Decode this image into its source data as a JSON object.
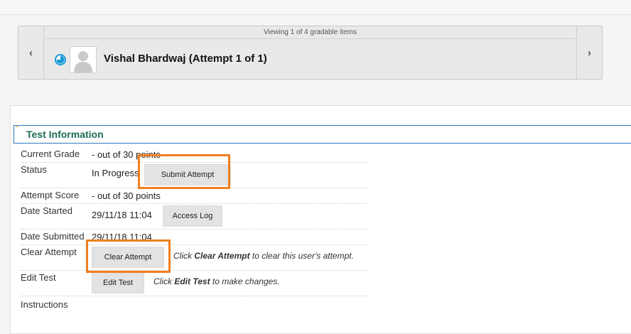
{
  "navigator": {
    "viewing_text": "Viewing 1 of 4 gradable items",
    "prev_glyph": "‹",
    "next_glyph": "›",
    "user_name": "Vishal Bhardwaj (Attempt 1 of 1)"
  },
  "section": {
    "collapse_glyph": "ˆ",
    "title": "Test Information"
  },
  "rows": {
    "current_grade": {
      "label": "Current Grade",
      "value": "- out of 30 points"
    },
    "status": {
      "label": "Status",
      "value": "In Progress",
      "button": "Submit Attempt"
    },
    "attempt_score": {
      "label": "Attempt Score",
      "value": "- out of 30 points"
    },
    "date_started": {
      "label": "Date Started",
      "value": "29/11/18 11:04",
      "button": "Access Log"
    },
    "date_submitted": {
      "label": "Date Submitted",
      "value": "29/11/18 11:04"
    },
    "clear_attempt": {
      "label": "Clear Attempt",
      "button": "Clear Attempt",
      "hint_pre": "Click ",
      "hint_bold": "Clear Attempt",
      "hint_post": " to clear this user's attempt."
    },
    "edit_test": {
      "label": "Edit Test",
      "button": "Edit Test",
      "hint_pre": "Click ",
      "hint_bold": "Edit Test",
      "hint_post": " to make changes."
    },
    "instructions": {
      "label": "Instructions"
    }
  },
  "colors": {
    "highlight": "#ee7f20",
    "section_title": "#1e6b59",
    "section_border": "#2f7bc0"
  }
}
